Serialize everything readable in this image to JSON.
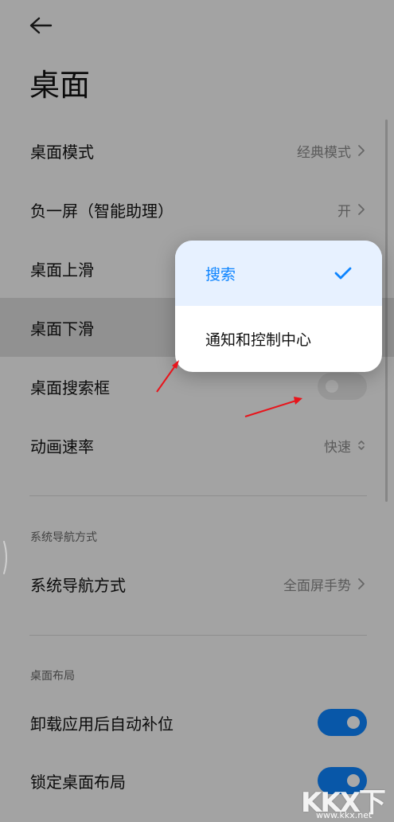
{
  "header": {
    "title": "桌面"
  },
  "settings": [
    {
      "label": "桌面模式",
      "value": "经典模式"
    },
    {
      "label": "负一屏（智能助理）",
      "value": "开"
    },
    {
      "label": "桌面上滑",
      "value": ""
    },
    {
      "label": "桌面下滑",
      "value": ""
    },
    {
      "label": "桌面搜索框",
      "toggle": "off"
    },
    {
      "label": "动画速率",
      "value": "快速"
    }
  ],
  "nav_section": {
    "header": "系统导航方式",
    "item": {
      "label": "系统导航方式",
      "value": "全面屏手势"
    }
  },
  "layout_section": {
    "header": "桌面布局",
    "items": [
      {
        "label": "卸载应用后自动补位",
        "toggle": "on"
      },
      {
        "label": "锁定桌面布局",
        "toggle": "on"
      }
    ]
  },
  "popup": {
    "options": [
      {
        "label": "搜索",
        "selected": true
      },
      {
        "label": "通知和控制中心",
        "selected": false
      }
    ]
  },
  "colors": {
    "accent": "#0d84ff",
    "annotation_arrow": "#e8141b"
  },
  "watermark": {
    "logo": "KKX下载",
    "url": "www.kkx.net"
  }
}
